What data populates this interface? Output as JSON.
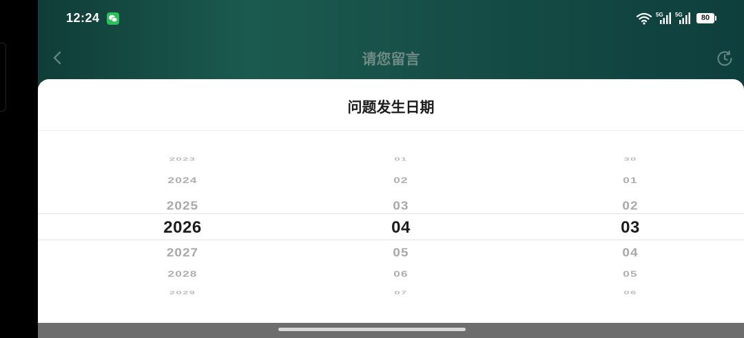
{
  "status_bar": {
    "time": "12:24",
    "signal_1_label": "5G",
    "signal_2_label": "5G",
    "battery": "80"
  },
  "nav": {
    "title": "请您留言"
  },
  "sheet": {
    "title": "问题发生日期"
  },
  "picker": {
    "years": [
      "2023",
      "2024",
      "2025",
      "2026",
      "2027",
      "2028",
      "2029"
    ],
    "months": [
      "01",
      "02",
      "03",
      "04",
      "05",
      "06",
      "07"
    ],
    "days": [
      "30",
      "01",
      "02",
      "03",
      "04",
      "05",
      "06"
    ],
    "selected": {
      "year": "2026",
      "month": "04",
      "day": "03"
    }
  },
  "colors": {
    "header_gradient": [
      "#0f3d37",
      "#1b5a4f",
      "#0e3f3d"
    ],
    "selected_text": "#1c1c1c",
    "unselected_text": "#a8a8a8"
  }
}
